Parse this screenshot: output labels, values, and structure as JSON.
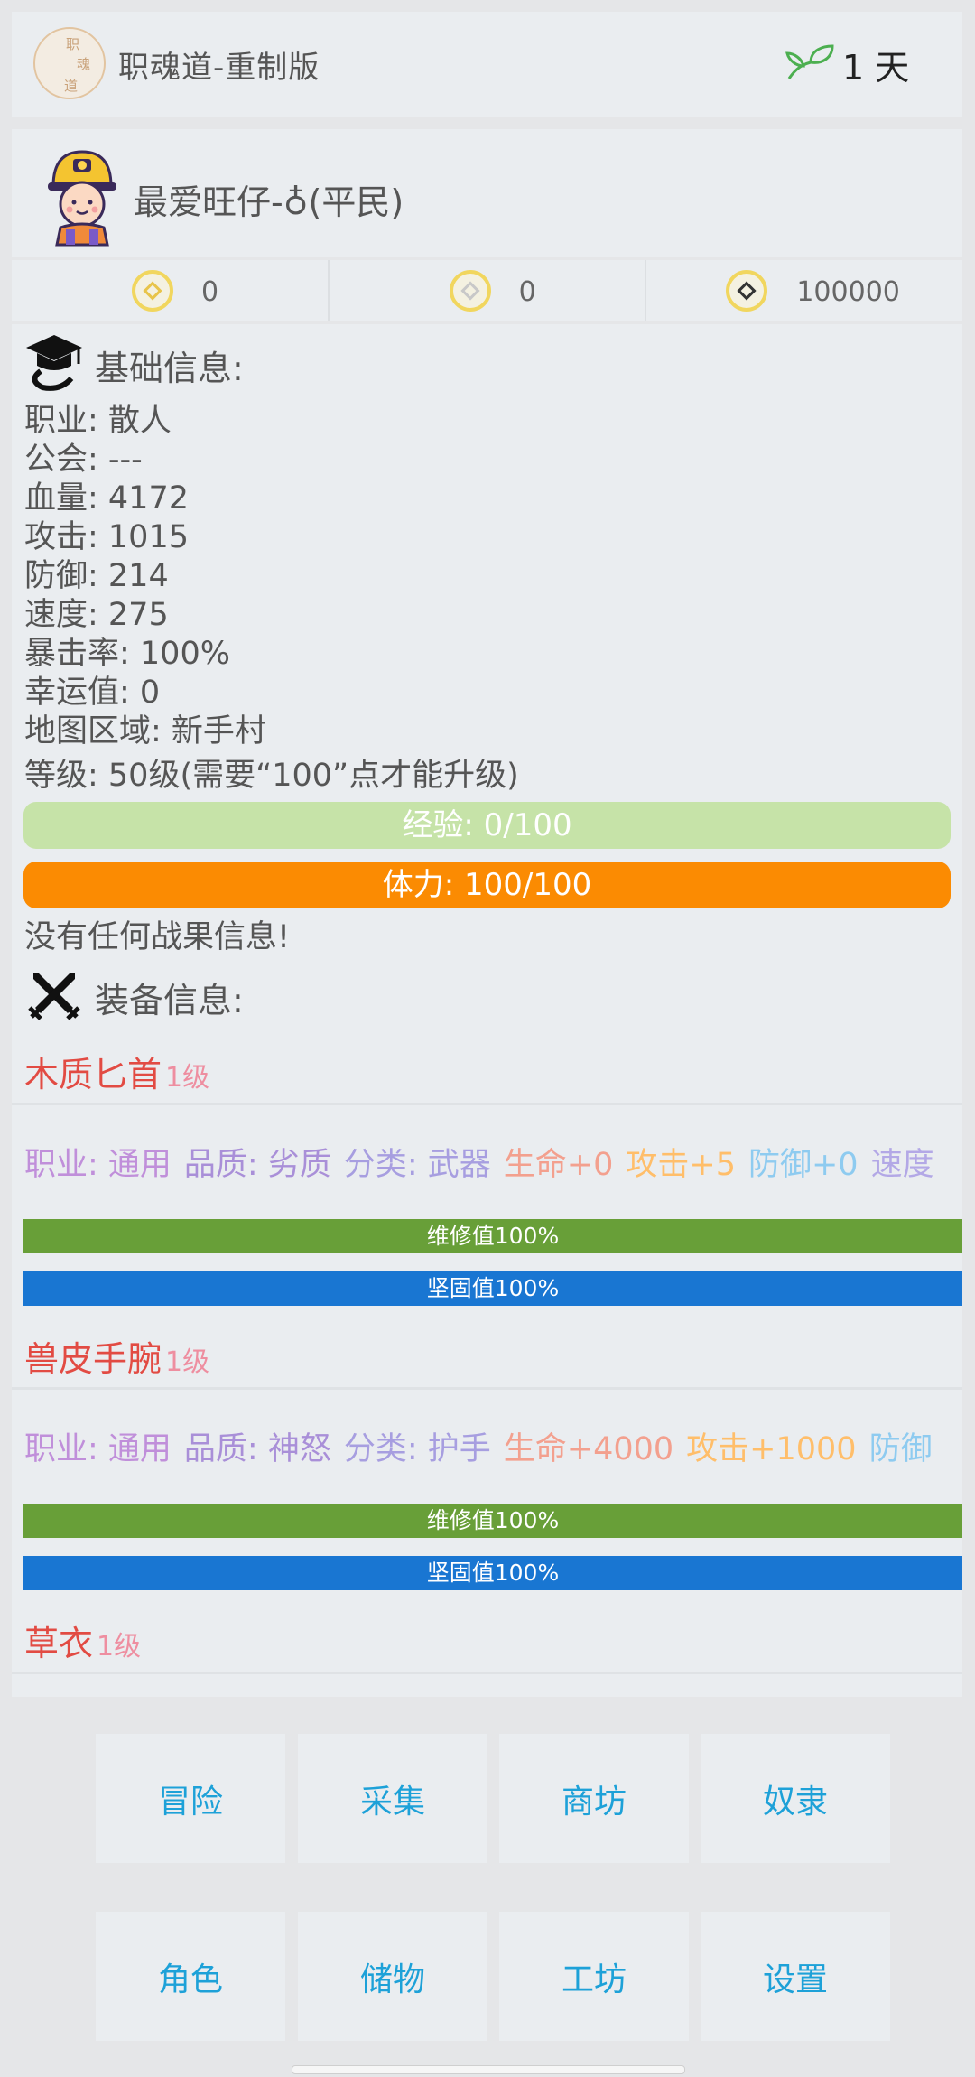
{
  "header": {
    "logo_chars": [
      "职",
      "魂",
      "道"
    ],
    "app_title": "职魂道-重制版",
    "leaf_icon": "leaf-icon",
    "days": "1 天"
  },
  "profile": {
    "avatar_icon": "miner-avatar-icon",
    "player_name": "最爱旺仔-♁(平民)"
  },
  "currency": [
    {
      "icon": "gold-coin-icon",
      "value": "0"
    },
    {
      "icon": "silver-coin-icon",
      "value": "0"
    },
    {
      "icon": "black-coin-icon",
      "value": "100000"
    }
  ],
  "basic_info": {
    "title": "基础信息:",
    "icon": "scholar-hat-icon",
    "stats": [
      "职业: 散人",
      "公会: ---",
      "血量: 4172",
      "攻击: 1015",
      "防御: 214",
      "速度: 275",
      "暴击率: 100%",
      "幸运值: 0",
      "地图区域: 新手村",
      "等级: 50级(需要“100”点才能升级)"
    ],
    "exp": {
      "label": "经验: 0/100",
      "current": 0,
      "max": 100
    },
    "stamina": {
      "label": "体力: 100/100",
      "current": 100,
      "max": 100
    },
    "battle_msg": "没有任何战果信息!"
  },
  "equipment": {
    "title": "装备信息:",
    "icon": "crossed-swords-icon",
    "items": [
      {
        "name": "木质匕首",
        "level": "1级",
        "attrs": [
          "职业: 通用",
          "品质: 劣质",
          "分类: 武器",
          "生命+0",
          "攻击+5",
          "防御+0",
          "速度"
        ],
        "repair": "维修值100%",
        "sturdy": "坚固值100%"
      },
      {
        "name": "兽皮手腕",
        "level": "1级",
        "attrs": [
          "职业: 通用",
          "品质: 神怒",
          "分类: 护手",
          "生命+4000",
          "攻击+1000",
          "防御"
        ],
        "repair": "维修值100%",
        "sturdy": "坚固值100%"
      },
      {
        "name": "草衣",
        "level": "1级"
      }
    ]
  },
  "colors": {
    "attr_colors": [
      "#c08fda",
      "#a98fd8",
      "#a79ee0",
      "#f3a08e",
      "#ffbe6a",
      "#8ecbf0",
      "#b3a8e6"
    ],
    "exp_bar": "#c6e3a8",
    "stamina_bar": "#fb8b02",
    "repair_bar": "#689f38",
    "sturdy_bar": "#1976d2",
    "item_name": "#e24b43",
    "nav_text": "#1da1d8"
  },
  "nav": [
    {
      "label": "冒险"
    },
    {
      "label": "采集"
    },
    {
      "label": "商坊"
    },
    {
      "label": "奴隶"
    },
    {
      "label": "角色"
    },
    {
      "label": "储物"
    },
    {
      "label": "工坊"
    },
    {
      "label": "设置"
    }
  ]
}
